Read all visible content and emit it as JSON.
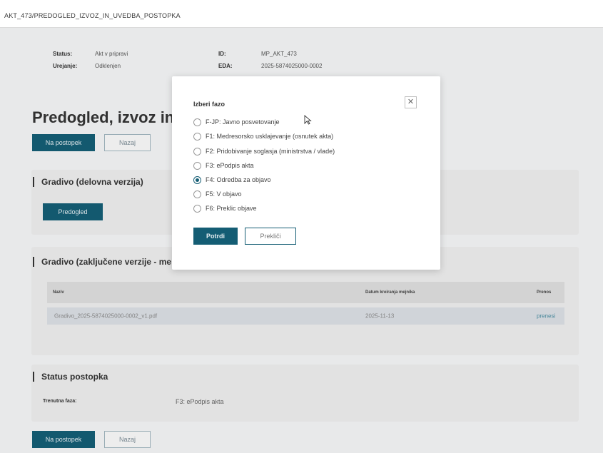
{
  "breadcrumb": "AKT_473/PREDOGLED_IZVOZ_IN_UVEDBA_POSTOPKA",
  "meta": {
    "status_label": "Status:",
    "status_value": "Akt v pripravi",
    "urejanje_label": "Urejanje:",
    "urejanje_value": "Odklenjen",
    "id_label": "ID:",
    "id_value": "MP_AKT_473",
    "eda_label": "EDA:",
    "eda_value": "2025-5874025000-0002"
  },
  "page_title": "Predogled, izvoz in uvedba postopka",
  "buttons": {
    "na_postopek": "Na postopek",
    "nazaj": "Nazaj"
  },
  "gradivo_delovna": {
    "title": "Gradivo (delovna verzija)",
    "predogled": "Predogled"
  },
  "gradivo_zakljucene": {
    "title": "Gradivo (zaključene verzije - me",
    "columns": [
      "Naziv",
      "Datum kreiranja mejnika",
      "Prenos"
    ],
    "rows": [
      {
        "naziv": "Gradivo_2025-5874025000-0002_v1.pdf",
        "datum": "2025-11-13",
        "prenos": "prenesi"
      }
    ]
  },
  "status_postopka": {
    "title": "Status postopka",
    "faza_label": "Trenutna faza:",
    "faza_value": "F3: ePodpis akta"
  },
  "modal": {
    "title": "Izberi fazo",
    "options": [
      {
        "label": "F-JP: Javno posvetovanje",
        "checked": false
      },
      {
        "label": "F1: Medresorsko usklajevanje (osnutek akta)",
        "checked": false
      },
      {
        "label": "F2: Pridobivanje soglasja (ministrstva / vlade)",
        "checked": false
      },
      {
        "label": "F3: ePodpis akta",
        "checked": false
      },
      {
        "label": "F4: Odredba za objavo",
        "checked": true
      },
      {
        "label": "F5: V objavo",
        "checked": false
      },
      {
        "label": "F6: Preklic objave",
        "checked": false
      }
    ],
    "confirm": "Potrdi",
    "cancel": "Prekliči",
    "close_icon": "close-icon"
  },
  "colors": {
    "primary": "#145d74",
    "background": "#f2f3f4",
    "card": "#ececec"
  }
}
